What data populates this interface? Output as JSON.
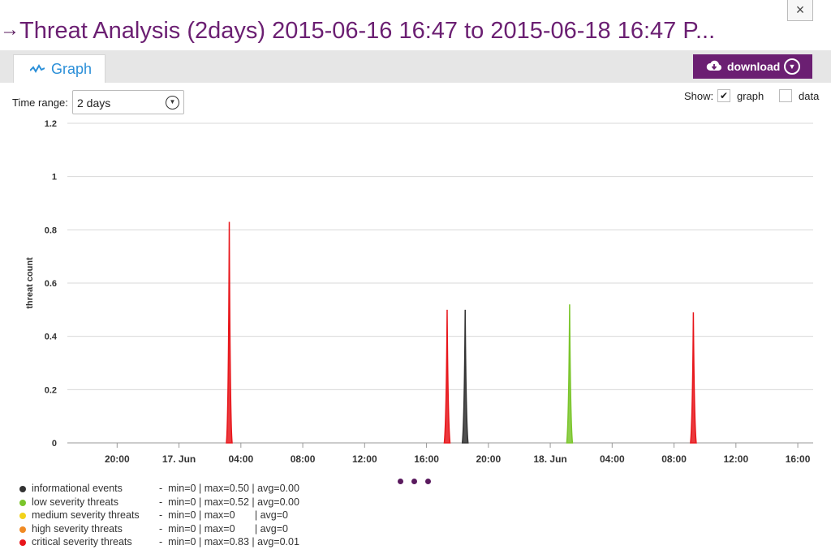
{
  "dialog": {
    "arrow": "→",
    "title": "Threat Analysis (2days) 2015-06-16 16:47 to 2015-06-18 16:47 P...",
    "close_label": "×"
  },
  "tabs": [
    {
      "label": "Graph",
      "icon": "line-chart-icon"
    }
  ],
  "download": {
    "label": "download",
    "icon": "cloud-download-icon"
  },
  "controls": {
    "time_range_label": "Time range:",
    "time_range_value": "2 days",
    "show_label": "Show:",
    "graph_label": "graph",
    "graph_checked": true,
    "data_label": "data",
    "data_checked": false
  },
  "chart_data": {
    "type": "area",
    "ylabel": "threat count",
    "ylim": [
      0,
      1.2
    ],
    "yticks": [
      "0",
      "0.2",
      "0.4",
      "0.6",
      "0.8",
      "1",
      "1.2"
    ],
    "xticks": [
      "20:00",
      "17. Jun",
      "04:00",
      "08:00",
      "12:00",
      "16:00",
      "20:00",
      "18. Jun",
      "04:00",
      "08:00",
      "12:00",
      "16:00"
    ],
    "x_range": [
      "2015-06-16 16:47",
      "2015-06-18 16:47"
    ],
    "grid": true,
    "series": [
      {
        "name": "informational events",
        "color": "#333333",
        "points": [
          {
            "x": "2015-06-17 18:30",
            "y": 0.5
          }
        ]
      },
      {
        "name": "low severity threats",
        "color": "#7ac52b",
        "points": [
          {
            "x": "2015-06-18 01:15",
            "y": 0.52
          }
        ]
      },
      {
        "name": "medium severity threats",
        "color": "#f2d21b",
        "points": []
      },
      {
        "name": "high severity threats",
        "color": "#f08a24",
        "points": []
      },
      {
        "name": "critical severity threats",
        "color": "#e8161b",
        "points": [
          {
            "x": "2015-06-17 03:15",
            "y": 0.83
          },
          {
            "x": "2015-06-17 17:20",
            "y": 0.5
          },
          {
            "x": "2015-06-18 09:15",
            "y": 0.49
          }
        ]
      }
    ]
  },
  "legend": [
    {
      "name": "informational events",
      "color": "#333333",
      "stats": "-  min=0 | max=0.50 | avg=0.00"
    },
    {
      "name": "low severity threats",
      "color": "#7ac52b",
      "stats": "-  min=0 | max=0.52 | avg=0.00"
    },
    {
      "name": "medium severity threats",
      "color": "#f2d21b",
      "stats": "-  min=0 | max=0       | avg=0"
    },
    {
      "name": "high severity threats",
      "color": "#f08a24",
      "stats": "-  min=0 | max=0       | avg=0"
    },
    {
      "name": "critical severity threats",
      "color": "#e8161b",
      "stats": "-  min=0 | max=0.83 | avg=0.01"
    }
  ],
  "pager": {
    "pages": 3
  }
}
